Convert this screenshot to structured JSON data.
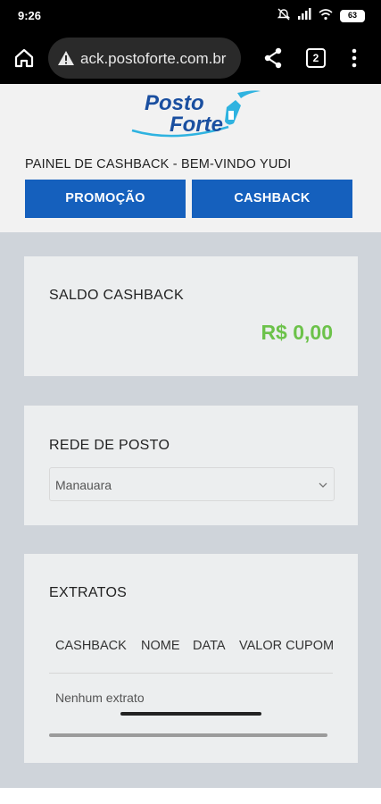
{
  "status_bar": {
    "time": "9:26",
    "battery": "63"
  },
  "browser": {
    "url": "ack.postoforte.com.br",
    "tab_count": "2"
  },
  "header": {
    "logo_line1": "Posto",
    "logo_line2": "Forte",
    "welcome": "PAINEL DE CASHBACK - BEM-VINDO YUDI",
    "buttons": {
      "promo": "PROMOÇÃO",
      "cashback": "CASHBACK"
    }
  },
  "saldo": {
    "title": "SALDO CASHBACK",
    "value": "R$ 0,00"
  },
  "rede": {
    "title": "REDE DE POSTO",
    "selected": "Manauara"
  },
  "extratos": {
    "title": "EXTRATOS",
    "columns": [
      "CASHBACK",
      "NOME",
      "DATA",
      "VALOR CUPOM"
    ],
    "empty": "Nenhum extrato"
  },
  "colors": {
    "primary_button": "#1560bd",
    "balance_green": "#6cc24a",
    "logo_blue": "#1a4fa0",
    "logo_cyan": "#2fb3e0"
  }
}
